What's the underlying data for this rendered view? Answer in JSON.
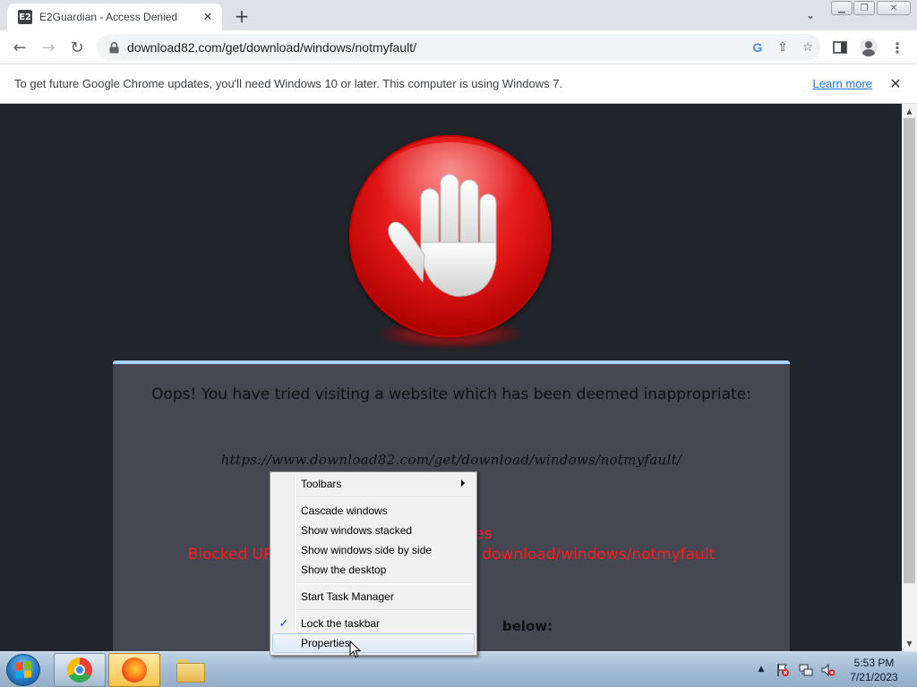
{
  "browser": {
    "tab": {
      "favicon_text": "E2",
      "title": "E2Guardian - Access Denied",
      "close_glyph": "✕"
    },
    "new_tab_glyph": "+",
    "tab_search_glyph": "⌄",
    "window_controls": {
      "minimize": "▁",
      "maximize": "❐",
      "close": "✕"
    },
    "nav": {
      "back": "←",
      "forward": "→",
      "reload": "↻"
    },
    "address": "download82.com/get/download/windows/notmyfault/",
    "omni_icons": {
      "google": "G",
      "share": "⇪",
      "bookmark": "☆"
    },
    "menu_glyph": "⋮"
  },
  "infobar": {
    "message": "To get future Google Chrome updates, you'll need Windows 10 or later. This computer is using Windows 7.",
    "link": "Learn more",
    "close_glyph": "✕"
  },
  "page": {
    "heading": "Oops! You have tried visiting a website which has been deemed inappropriate:",
    "blocked_url": "https://www.download82.com/get/download/windows/notmyfault/",
    "red_line_1": "s Websites",
    "red_line_2": "Blocked UR                                           download/windows/notmyfault",
    "below_text": "below:",
    "colors": {
      "background": "#22242b",
      "panel": "#454852",
      "panel_border": "#a8d2f5",
      "alert_red": "#ff1a1a"
    }
  },
  "scrollbar": {
    "up_glyph": "▲",
    "down_glyph": "▼"
  },
  "taskbar": {
    "tray_arrow": "▲",
    "clock": {
      "time": "5:53 PM",
      "date": "7/21/2023"
    }
  },
  "context_menu": {
    "items": [
      {
        "label": "Toolbars",
        "submenu": true
      },
      {
        "label": "Cascade windows"
      },
      {
        "label": "Show windows stacked"
      },
      {
        "label": "Show windows side by side"
      },
      {
        "label": "Show the desktop"
      },
      {
        "label": "Start Task Manager"
      },
      {
        "label": "Lock the taskbar",
        "checked": true,
        "check_glyph": "✓"
      },
      {
        "label": "Properties",
        "highlighted": true
      }
    ]
  }
}
